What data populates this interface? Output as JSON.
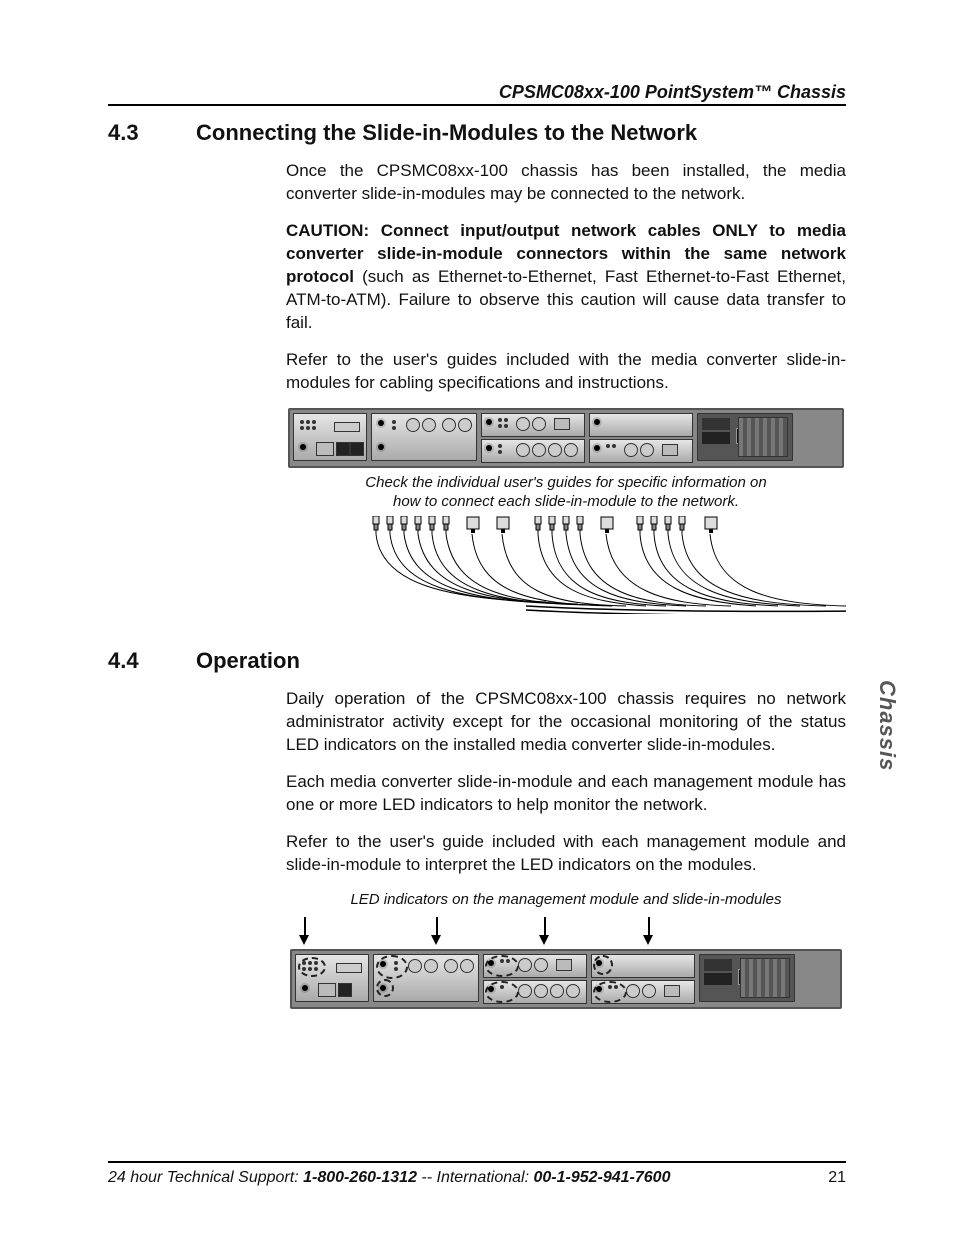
{
  "header": {
    "product": "CPSMC08xx-100 PointSystem™ Chassis"
  },
  "sections": {
    "s43": {
      "number": "4.3",
      "title": "Connecting the Slide-in-Modules to the Network",
      "p1": "Once the CPSMC08xx-100 chassis has been installed, the media converter slide-in-modules may be connected to the network.",
      "caution_lead": "CAUTION:  Connect input/output network cables ONLY to media converter slide-in-module connectors within the same network protocol",
      "caution_tail": " (such as Ethernet-to-Ethernet, Fast Ethernet-to-Fast Ethernet, ATM-to-ATM).  Failure to observe this caution will cause data transfer to fail.",
      "p3": "Refer to the user's guides included with the media converter slide-in-modules for cabling specifications and instructions.",
      "fig_caption_l1": "Check the individual user's guides for specific information on",
      "fig_caption_l2": "how to connect each slide-in-module to the network."
    },
    "s44": {
      "number": "4.4",
      "title": "Operation",
      "p1": "Daily operation of the CPSMC08xx-100 chassis requires no network administrator activity except for the occasional monitoring of the status LED indicators on the installed media converter slide-in-modules.",
      "p2": "Each media converter slide-in-module and each management module has one or more LED indicators to help monitor the network.",
      "p3": "Refer to the user's guide included with each management module and slide-in-module to interpret the LED indicators on the modules.",
      "fig_caption": "LED indicators on the management module and slide-in-modules"
    }
  },
  "side_tab": "Chassis",
  "footer": {
    "support_label": "24 hour Technical Support:  ",
    "support_phone": "1-800-260-1312",
    "sep": " -- International: ",
    "intl_phone": "00-1-952-941-7600",
    "page": "21"
  },
  "icons": {
    "fiber_plug": "fiber",
    "rj45_plug": "rj45"
  }
}
